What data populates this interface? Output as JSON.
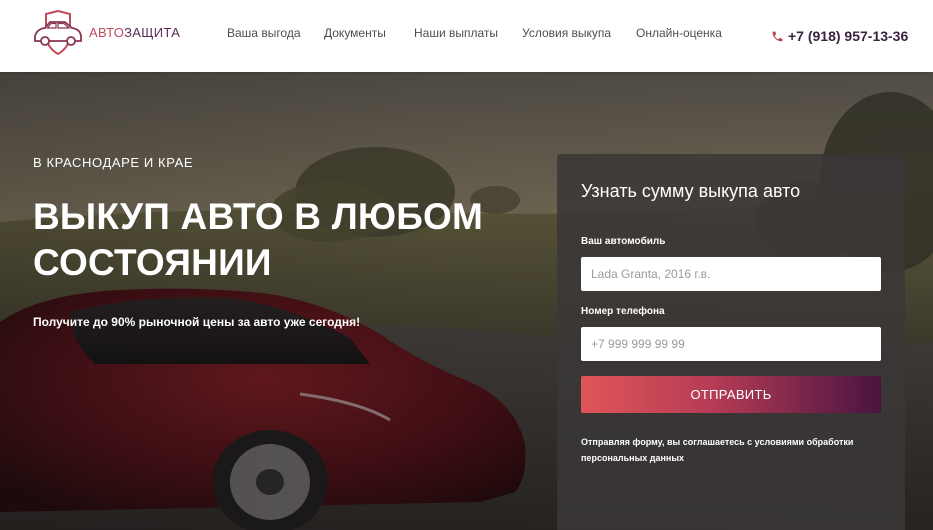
{
  "header": {
    "brand_part1": "АВТО",
    "brand_part2": "ЗАЩИТА",
    "nav": [
      {
        "label": "Ваша выгода"
      },
      {
        "label": "Документы"
      },
      {
        "label": "Наши выплаты"
      },
      {
        "label": "Условия выкупа"
      },
      {
        "label": "Онлайн-оценка"
      }
    ],
    "phone": "+7 (918) 957-13-36",
    "logo_icon": "car-shield-icon",
    "phone_icon": "phone-icon"
  },
  "hero": {
    "kicker": "В КРАСНОДАРЕ И КРАЕ",
    "title": "ВЫКУП АВТО В ЛЮБОМ СОСТОЯНИИ",
    "subtitle": "Получите до 90% рыночной цены за авто уже сегодня!"
  },
  "form": {
    "title": "Узнать сумму выкупа авто",
    "car_label": "Ваш автомобиль",
    "car_placeholder": "Lada Granta, 2016 г.в.",
    "phone_label": "Номер телефона",
    "phone_placeholder": "+7 999 999 99 99",
    "submit_label": "ОТПРАВИТЬ",
    "consent": "Отправляя форму, вы соглашаетесь с условиями обработки персональных данных"
  },
  "colors": {
    "brand_red": "#c04a58",
    "brand_purple": "#5b2a55",
    "button_start": "#e05558",
    "button_end": "#4a1340"
  }
}
